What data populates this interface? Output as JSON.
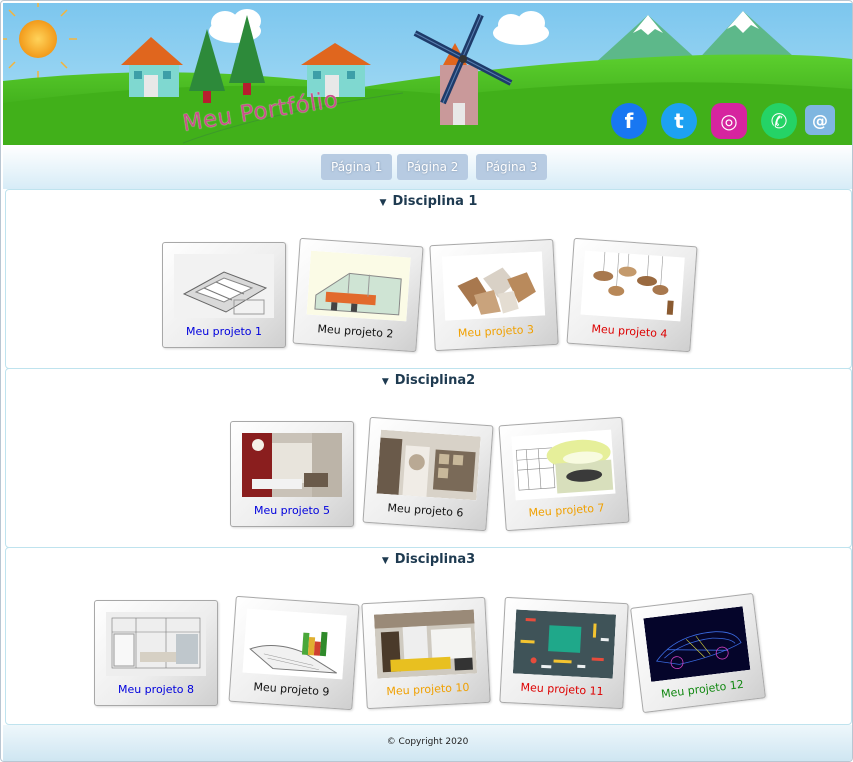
{
  "header": {
    "title": "Meu Portfólio",
    "social": [
      {
        "name": "facebook-icon",
        "glyph": "f",
        "color": "#1877f2"
      },
      {
        "name": "twitter-icon",
        "glyph": "t",
        "color": "#1da1f2"
      },
      {
        "name": "instagram-icon",
        "glyph": "◎",
        "color": "#d6249f"
      },
      {
        "name": "whatsapp-icon",
        "glyph": "✆",
        "color": "#25d366"
      },
      {
        "name": "email-icon",
        "glyph": "@",
        "color": "#7fb6e0"
      }
    ]
  },
  "nav": {
    "page1": "Página 1",
    "page2": "Página 2",
    "page3": "Página 3"
  },
  "sections": [
    {
      "title": "Disciplina 1"
    },
    {
      "title": "Disciplina2"
    },
    {
      "title": "Disciplina3"
    }
  ],
  "projects": [
    {
      "label": "Meu projeto 1",
      "color": "#0000dd"
    },
    {
      "label": "Meu projeto 2",
      "color": "#111111"
    },
    {
      "label": "Meu projeto 3",
      "color": "#f0a000"
    },
    {
      "label": "Meu projeto 4",
      "color": "#dd0000"
    },
    {
      "label": "Meu projeto 5",
      "color": "#0000dd"
    },
    {
      "label": "Meu projeto 6",
      "color": "#111111"
    },
    {
      "label": "Meu projeto 7",
      "color": "#f0a000"
    },
    {
      "label": "Meu projeto 8",
      "color": "#0000dd"
    },
    {
      "label": "Meu projeto 9",
      "color": "#111111"
    },
    {
      "label": "Meu projeto 10",
      "color": "#f0a000"
    },
    {
      "label": "Meu projeto 11",
      "color": "#dd0000"
    },
    {
      "label": "Meu projeto 12",
      "color": "#118811"
    }
  ],
  "footer": {
    "copyright": "© Copyright 2020"
  }
}
